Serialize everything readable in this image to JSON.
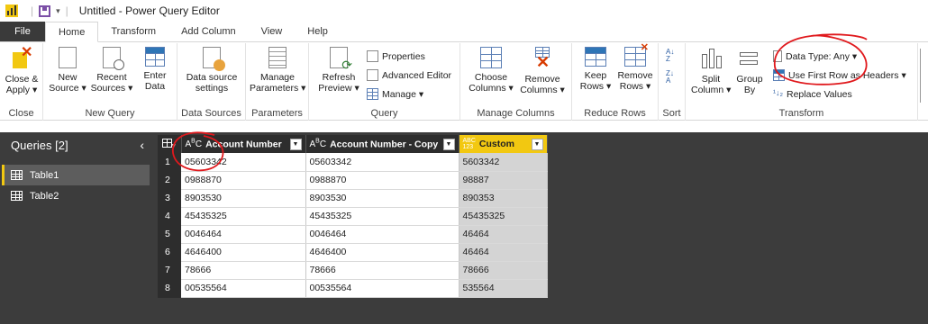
{
  "titlebar": {
    "title": "Untitled - Power Query Editor"
  },
  "tabs": [
    "File",
    "Home",
    "Transform",
    "Add Column",
    "View",
    "Help"
  ],
  "ribbon": {
    "close": {
      "btn": "Close &\nApply ▾",
      "label": "Close"
    },
    "new_query": {
      "new_source": "New\nSource ▾",
      "recent_sources": "Recent\nSources ▾",
      "enter_data": "Enter\nData",
      "label": "New Query"
    },
    "data_sources": {
      "btn": "Data source\nsettings",
      "label": "Data Sources"
    },
    "parameters": {
      "btn": "Manage\nParameters ▾",
      "label": "Parameters"
    },
    "query": {
      "refresh": "Refresh\nPreview ▾",
      "properties": "Properties",
      "advanced_editor": "Advanced Editor",
      "manage": "Manage ▾",
      "label": "Query"
    },
    "manage_columns": {
      "choose": "Choose\nColumns ▾",
      "remove": "Remove\nColumns ▾",
      "label": "Manage Columns"
    },
    "reduce_rows": {
      "keep": "Keep\nRows ▾",
      "remove": "Remove\nRows ▾",
      "label": "Reduce Rows"
    },
    "sort": {
      "label": "Sort"
    },
    "transform": {
      "split": "Split\nColumn ▾",
      "group": "Group\nBy",
      "data_type": "Data Type: Any ▾",
      "first_row": "Use First Row as Headers ▾",
      "replace": "Replace Values",
      "label": "Transform"
    }
  },
  "queries": {
    "header": "Queries [2]",
    "items": [
      {
        "label": "Table1"
      },
      {
        "label": "Table2"
      }
    ]
  },
  "table": {
    "columns": [
      "Account Number",
      "Account Number - Copy",
      "Custom"
    ],
    "rows": [
      [
        "05603342",
        "05603342",
        "5603342"
      ],
      [
        "0988870",
        "0988870",
        "98887"
      ],
      [
        "8903530",
        "8903530",
        "890353"
      ],
      [
        "45435325",
        "45435325",
        "45435325"
      ],
      [
        "0046464",
        "0046464",
        "46464"
      ],
      [
        "4646400",
        "4646400",
        "46464"
      ],
      [
        "78666",
        "78666",
        "78666"
      ],
      [
        "00535564",
        "00535564",
        "535564"
      ]
    ]
  },
  "colors": {
    "accent": "#f2c811",
    "panel": "#3c3c3c",
    "annotation": "#e0191d"
  }
}
